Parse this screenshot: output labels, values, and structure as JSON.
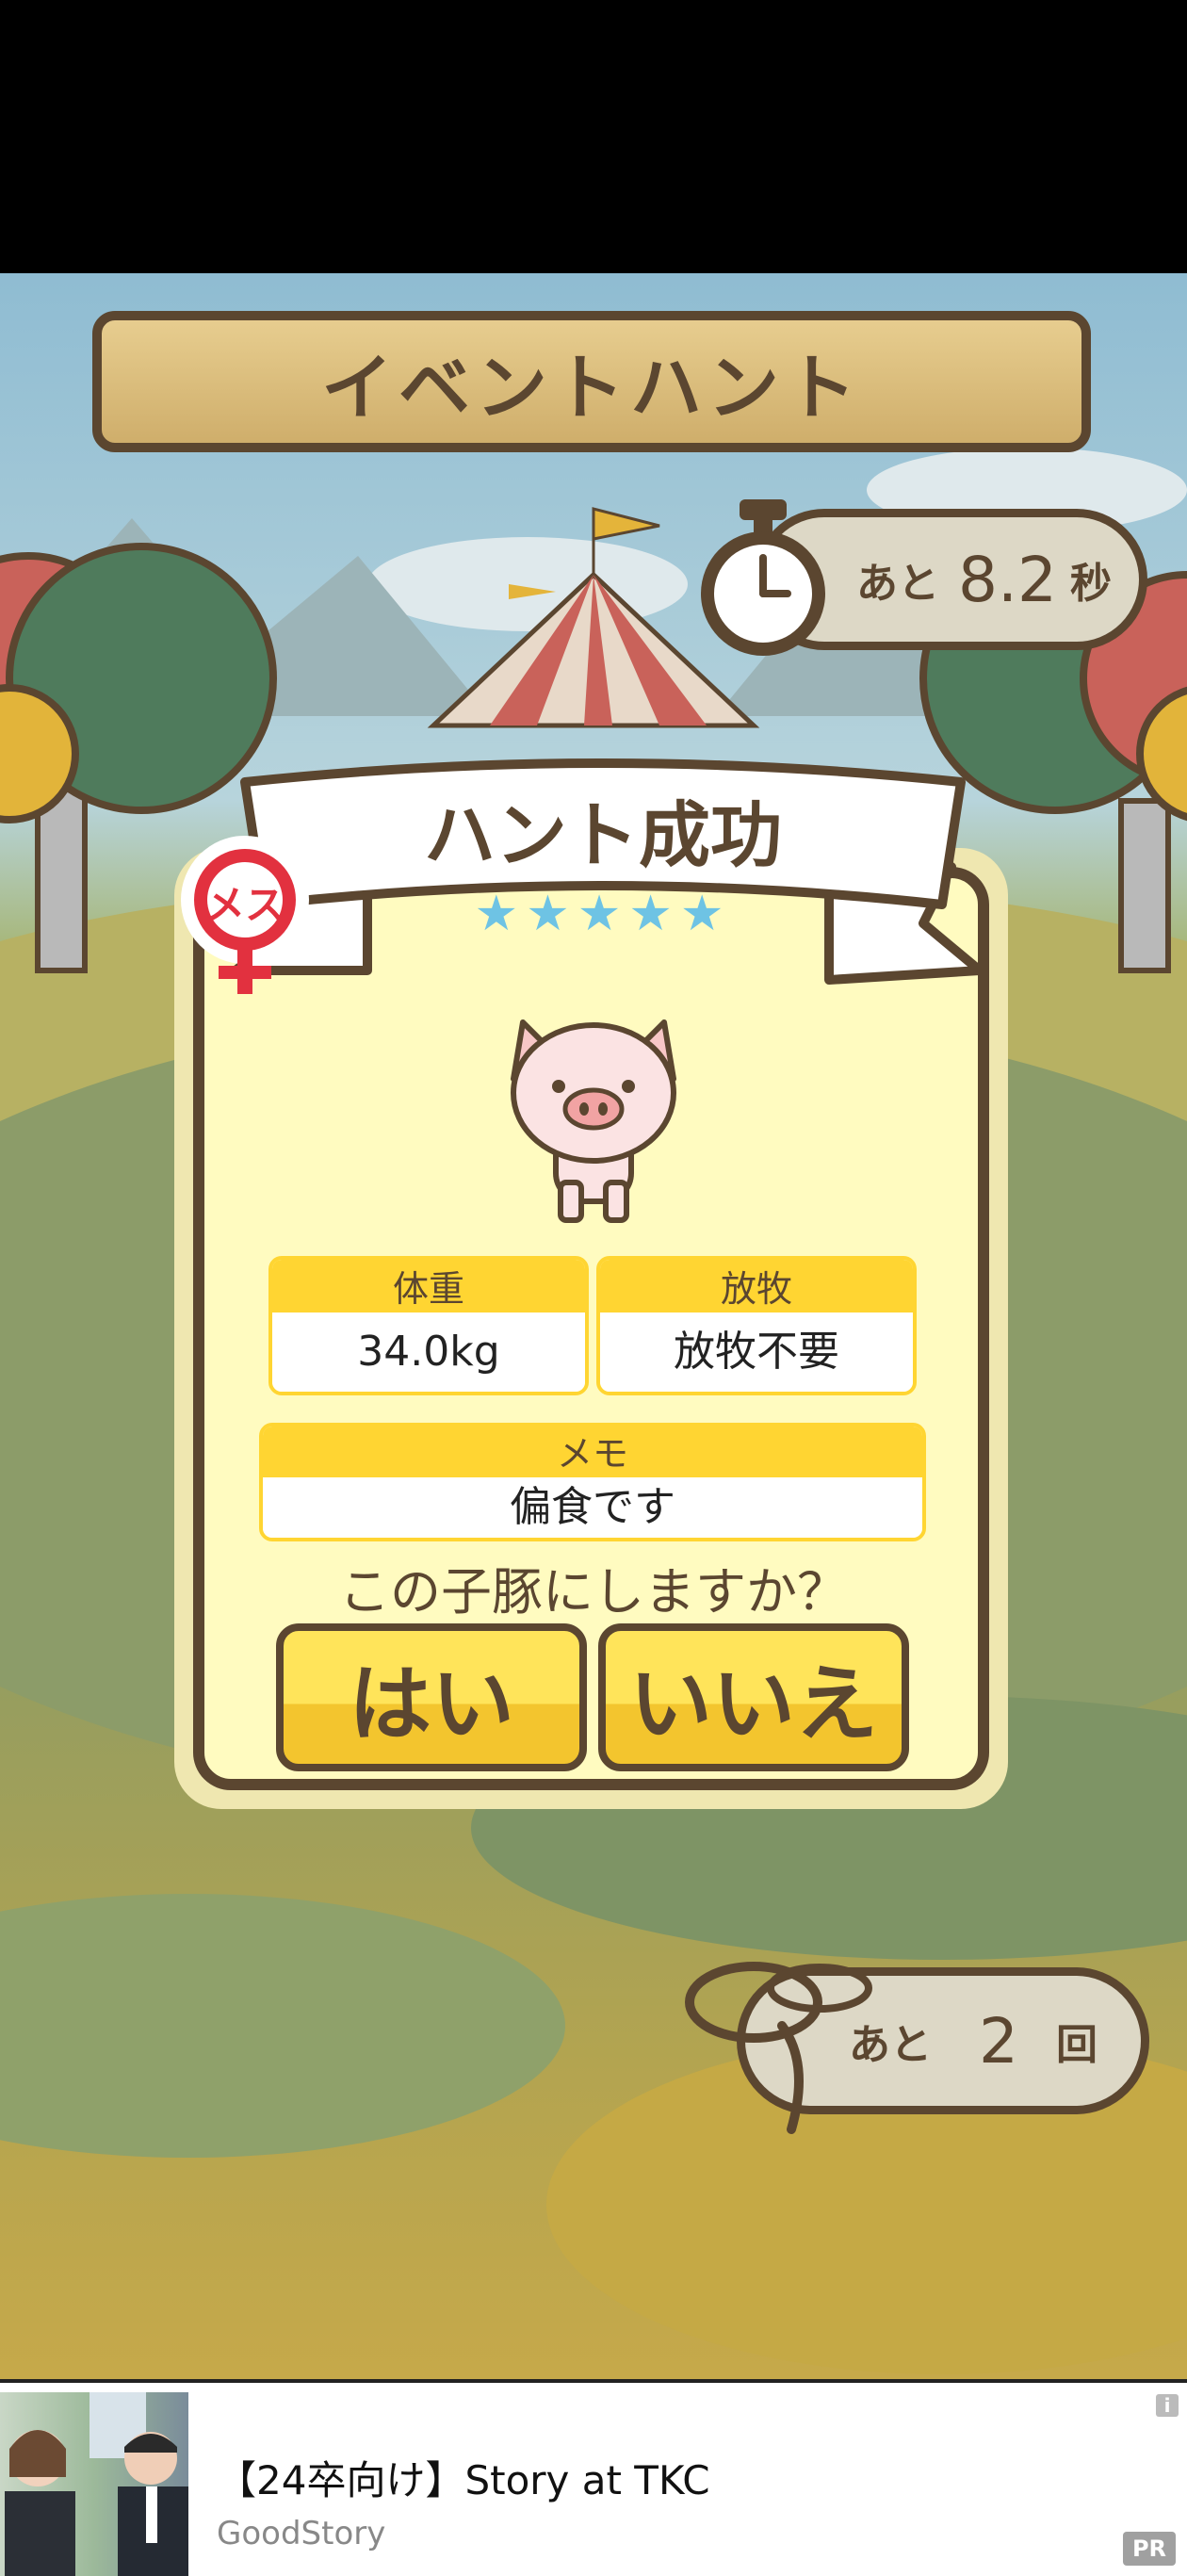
{
  "header": {
    "title": "イベントハント"
  },
  "timer": {
    "prefix": "あと",
    "value": "8.2",
    "unit": "秒"
  },
  "result": {
    "banner": "ハント成功",
    "gender_badge": "メス",
    "stars": "★★★★★",
    "weight": {
      "label": "体重",
      "value": "34.0kg"
    },
    "grazing": {
      "label": "放牧",
      "value": "放牧不要"
    },
    "memo": {
      "label": "メモ",
      "value": "偏食です"
    },
    "question": "この子豚にしますか？",
    "yes_label": "はい",
    "no_label": "いいえ"
  },
  "remaining": {
    "prefix": "あと",
    "value": "2",
    "unit": "回"
  },
  "ad": {
    "title": "【24卒向け】Story at TKC",
    "advertiser": "GoodStory",
    "pr_badge": "PR",
    "info_icon": "i"
  },
  "colors": {
    "sky": "#9fc5d6",
    "grass": "#8a9a64",
    "frame_brown": "#5b4630",
    "card_cream": "#fffbc0",
    "field_yellow": "#ffd532",
    "star_blue": "#6ec3e4",
    "badge_red": "#e2313f"
  }
}
